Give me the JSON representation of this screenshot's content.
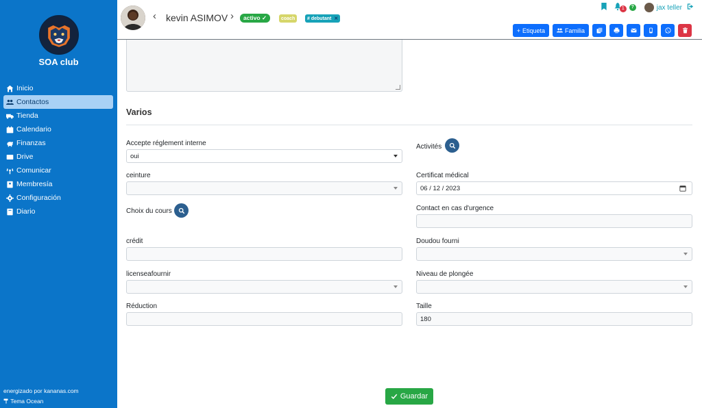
{
  "sidebar": {
    "club_name": "SOA club",
    "items": [
      {
        "label": "Inicio",
        "icon": "home-icon"
      },
      {
        "label": "Contactos",
        "icon": "users-icon",
        "active": true
      },
      {
        "label": "Tienda",
        "icon": "truck-icon"
      },
      {
        "label": "Calendario",
        "icon": "calendar-icon"
      },
      {
        "label": "Finanzas",
        "icon": "piggy-bank-icon"
      },
      {
        "label": "Drive",
        "icon": "drive-icon"
      },
      {
        "label": "Comunicar",
        "icon": "broadcast-icon"
      },
      {
        "label": "Membresía",
        "icon": "id-card-icon"
      },
      {
        "label": "Configuración",
        "icon": "gear-icon"
      },
      {
        "label": "Diario",
        "icon": "journal-icon"
      }
    ],
    "footer_powered": "energizado por kananas.com",
    "footer_theme": "Tema Ocean"
  },
  "header": {
    "contact_name": "kevin ASIMOV",
    "badge_status": "activo",
    "badge_role": "coach",
    "badge_tag": "# debutant",
    "notification_count": "1",
    "help_label": "?",
    "user_name": "jax teller",
    "toolbar": {
      "etiqueta_label": "Etiqueta",
      "familia_label": "Familia"
    }
  },
  "form": {
    "section_title": "Varios",
    "fields": {
      "accepte_label": "Accepte réglement interne",
      "accepte_value": "oui",
      "activites_label": "Activités",
      "ceinture_label": "ceinture",
      "certificat_label": "Certificat médical",
      "certificat_value": "06 / 12 / 2023",
      "choix_label": "Choix du cours",
      "contact_urgence_label": "Contact en cas d'urgence",
      "credit_label": "crédit",
      "doudou_label": "Doudou fourni",
      "license_label": "licenseafournir",
      "niveau_label": "Niveau de plongée",
      "reduction_label": "Réduction",
      "taille_label": "Taille",
      "taille_value": "180"
    },
    "save_label": "Guardar"
  },
  "colors": {
    "sidebar_bg": "#0b75c9",
    "primary": "#0d6efd",
    "success": "#28a745",
    "danger": "#dc3545",
    "info": "#17a2b8"
  }
}
